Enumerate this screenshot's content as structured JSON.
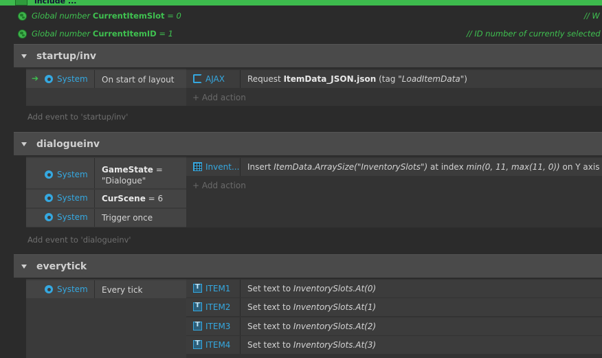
{
  "topbar": {
    "text": "include ..."
  },
  "globals": [
    {
      "prefix": "Global number",
      "name": "CurrentItemSlot",
      "value": "= 0",
      "comment": "//  W"
    },
    {
      "prefix": "Global number",
      "name": "CurrentItemID",
      "value": "= 1",
      "comment": "//  ID number of currently selected item"
    }
  ],
  "groups": [
    {
      "name": "startup/inv",
      "add_event": "Add event to 'startup/inv'"
    },
    {
      "name": "dialogueinv",
      "add_event": "Add event to 'dialogueinv'"
    },
    {
      "name": "everytick"
    }
  ],
  "events": {
    "startup": {
      "conditions": [
        {
          "object": "System",
          "text": "On start of layout"
        }
      ],
      "actions": [
        {
          "object": "AJAX",
          "pre": "Request ",
          "bold": "ItemData_JSON.json",
          "post": " (tag ",
          "italic": "\"LoadItemData\"",
          "end": ")"
        }
      ],
      "add_action": "Add action"
    },
    "dialogue": {
      "conditions": [
        {
          "object": "System",
          "bold": "GameState",
          "text": " = \"Dialogue\""
        },
        {
          "object": "System",
          "bold": "CurScene",
          "text": " = 6"
        },
        {
          "object": "System",
          "text": "Trigger once"
        }
      ],
      "actions": [
        {
          "object": "Invent...",
          "pre": "Insert ",
          "italic": "ItemData.ArraySize(\"InventorySlots\")",
          "mid": " at index ",
          "italic2": "min(0, 11, max(11, 0))",
          "end": " on Y axis"
        }
      ],
      "add_action": "Add action"
    },
    "everytick": {
      "conditions": [
        {
          "object": "System",
          "text": "Every tick"
        }
      ],
      "actions": [
        {
          "object": "ITEM1",
          "pre": "Set text to ",
          "italic": "InventorySlots.At(0)"
        },
        {
          "object": "ITEM2",
          "pre": "Set text to ",
          "italic": "InventorySlots.At(1)"
        },
        {
          "object": "ITEM3",
          "pre": "Set text to ",
          "italic": "InventorySlots.At(2)"
        },
        {
          "object": "ITEM4",
          "pre": "Set text to ",
          "italic": "InventorySlots.At(3)"
        }
      ]
    }
  },
  "colors": {
    "accent_green": "#3fc150",
    "object_blue": "#35a8e0",
    "topbar": "#3dbb4d"
  }
}
